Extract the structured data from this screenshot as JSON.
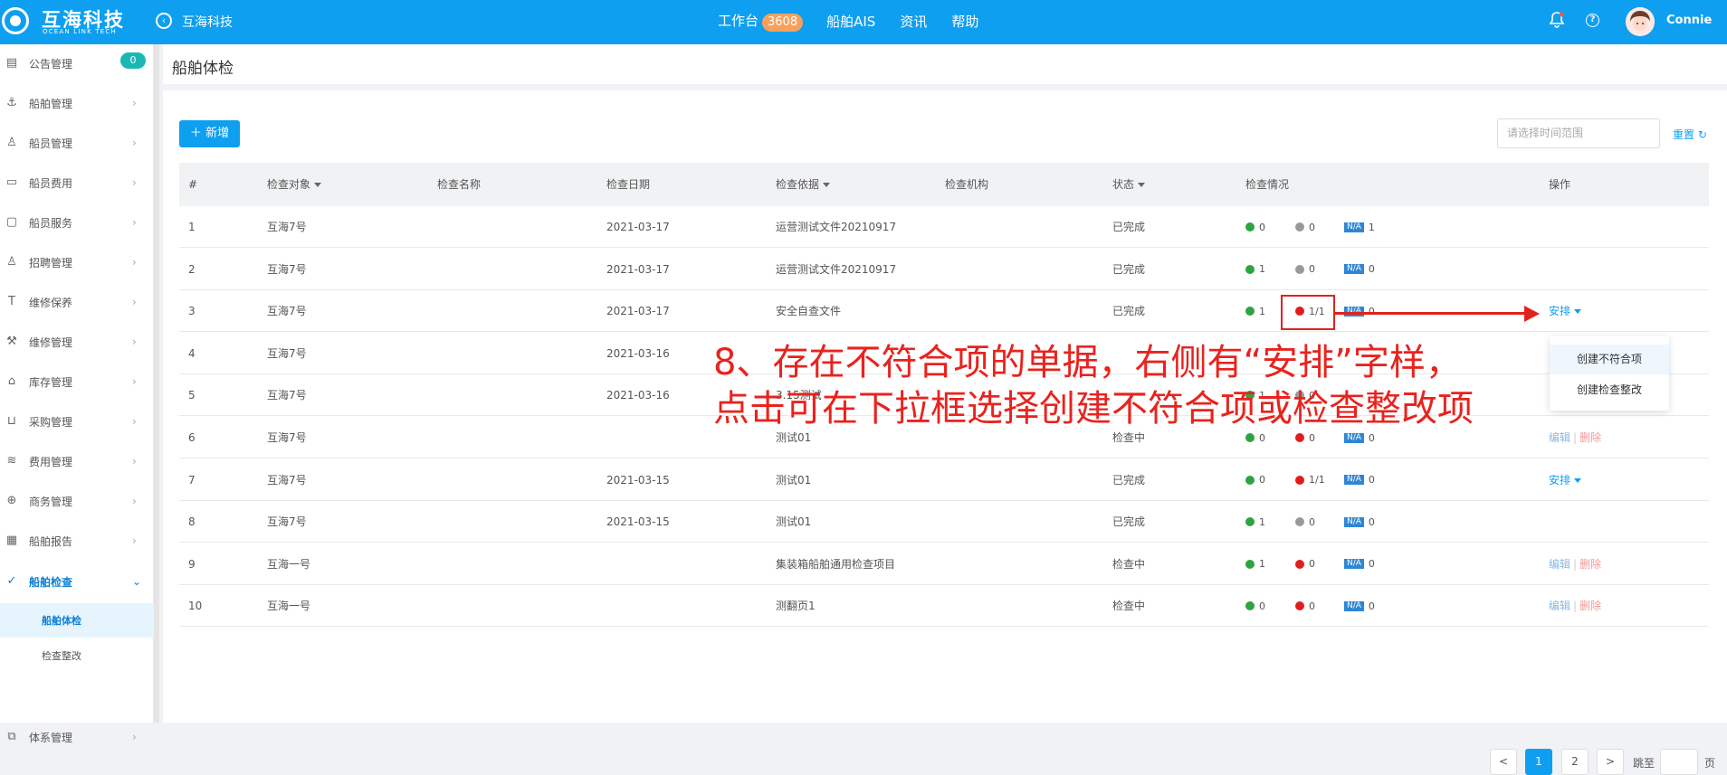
{
  "header": {
    "logo_cn": "互海科技",
    "logo_en": "OCEAN LINK TECH",
    "app_title": "互海科技",
    "nav": [
      {
        "label": "工作台",
        "badge": "3608"
      },
      {
        "label": "船舶AIS"
      },
      {
        "label": "资讯"
      },
      {
        "label": "帮助"
      }
    ],
    "user_name": "Connie",
    "help_glyph": "?"
  },
  "sidebar": {
    "items": [
      {
        "label": "公告管理",
        "icon": "book-icon",
        "badge": "0"
      },
      {
        "label": "船舶管理",
        "icon": "anchor-icon"
      },
      {
        "label": "船员管理",
        "icon": "person-icon"
      },
      {
        "label": "船员费用",
        "icon": "wallet-icon"
      },
      {
        "label": "船员服务",
        "icon": "monitor-icon"
      },
      {
        "label": "招聘管理",
        "icon": "person-search-icon"
      },
      {
        "label": "维修保养",
        "icon": "hammer-icon"
      },
      {
        "label": "维修管理",
        "icon": "wrench-icon"
      },
      {
        "label": "库存管理",
        "icon": "warehouse-icon"
      },
      {
        "label": "采购管理",
        "icon": "cart-icon"
      },
      {
        "label": "费用管理",
        "icon": "coins-icon"
      },
      {
        "label": "商务管理",
        "icon": "globe-icon"
      },
      {
        "label": "船舶报告",
        "icon": "grid-icon"
      },
      {
        "label": "船舶检查",
        "icon": "check-circle-icon"
      },
      {
        "label": "体系管理",
        "icon": "copy-icon"
      }
    ],
    "sub_items": [
      {
        "label": "船舶体检"
      },
      {
        "label": "检查整改"
      }
    ]
  },
  "page": {
    "title": "船舶体检",
    "new_button": "新增",
    "date_placeholder": "请选择时间范围",
    "reset_label": "重置"
  },
  "table": {
    "headers": [
      "#",
      "检查对象",
      "检查名称",
      "检查日期",
      "检查依据",
      "检查机构",
      "状态",
      "检查情况",
      "操作"
    ],
    "rows": [
      {
        "no": "1",
        "target": "互海7号",
        "name": "",
        "date": "2021-03-17",
        "basis": "运营测试文件20210917",
        "org": "",
        "status": "已完成",
        "ok": "0",
        "issue": "0",
        "na": "1",
        "issue_type": "gray",
        "action": ""
      },
      {
        "no": "2",
        "target": "互海7号",
        "name": "",
        "date": "2021-03-17",
        "basis": "运营测试文件20210917",
        "org": "",
        "status": "已完成",
        "ok": "1",
        "issue": "0",
        "na": "0",
        "issue_type": "gray",
        "action": ""
      },
      {
        "no": "3",
        "target": "互海7号",
        "name": "",
        "date": "2021-03-17",
        "basis": "安全自查文件",
        "org": "",
        "status": "已完成",
        "ok": "1",
        "issue": "1/1",
        "na": "0",
        "issue_type": "red",
        "action": "arrange"
      },
      {
        "no": "4",
        "target": "互海7号",
        "name": "",
        "date": "2021-03-16",
        "basis": "",
        "org": "",
        "status": "",
        "ok": "",
        "issue": "",
        "na": "",
        "issue_type": "none",
        "action": ""
      },
      {
        "no": "5",
        "target": "互海7号",
        "name": "",
        "date": "2021-03-16",
        "basis": "3.15测试",
        "org": "",
        "status": "",
        "ok": "1",
        "issue": "0",
        "na": "",
        "issue_type": "gray",
        "action": ""
      },
      {
        "no": "6",
        "target": "互海7号",
        "name": "",
        "date": "",
        "basis": "测试01",
        "org": "",
        "status": "检查中",
        "ok": "0",
        "issue": "0",
        "na": "0",
        "issue_type": "red",
        "action": "edit"
      },
      {
        "no": "7",
        "target": "互海7号",
        "name": "",
        "date": "2021-03-15",
        "basis": "测试01",
        "org": "",
        "status": "已完成",
        "ok": "0",
        "issue": "1/1",
        "na": "0",
        "issue_type": "red",
        "action": "arrange"
      },
      {
        "no": "8",
        "target": "互海7号",
        "name": "",
        "date": "2021-03-15",
        "basis": "测试01",
        "org": "",
        "status": "已完成",
        "ok": "1",
        "issue": "0",
        "na": "0",
        "issue_type": "gray",
        "action": ""
      },
      {
        "no": "9",
        "target": "互海一号",
        "name": "",
        "date": "",
        "basis": "集装箱船舶通用检查项目",
        "org": "",
        "status": "检查中",
        "ok": "1",
        "issue": "0",
        "na": "0",
        "issue_type": "red",
        "action": "edit"
      },
      {
        "no": "10",
        "target": "互海一号",
        "name": "",
        "date": "",
        "basis": "测翻页1",
        "org": "",
        "status": "检查中",
        "ok": "0",
        "issue": "0",
        "na": "0",
        "issue_type": "red",
        "action": "edit"
      }
    ],
    "na_tag": "N/A",
    "arrange_label": "安排",
    "edit_label": "编辑",
    "delete_label": "删除",
    "divider": "|"
  },
  "dropdown": {
    "options": [
      "创建不符合项",
      "创建检查整改"
    ]
  },
  "annotation": {
    "line1": "8、存在不符合项的单据，右侧有“安排”字样，",
    "line2": "点击可在下拉框选择创建不符合项或检查整改项"
  },
  "pagination": {
    "prev": "<",
    "pages": [
      "1",
      "2"
    ],
    "current": "1",
    "next": ">",
    "jump_label": "跳至",
    "page_suffix": "页"
  }
}
